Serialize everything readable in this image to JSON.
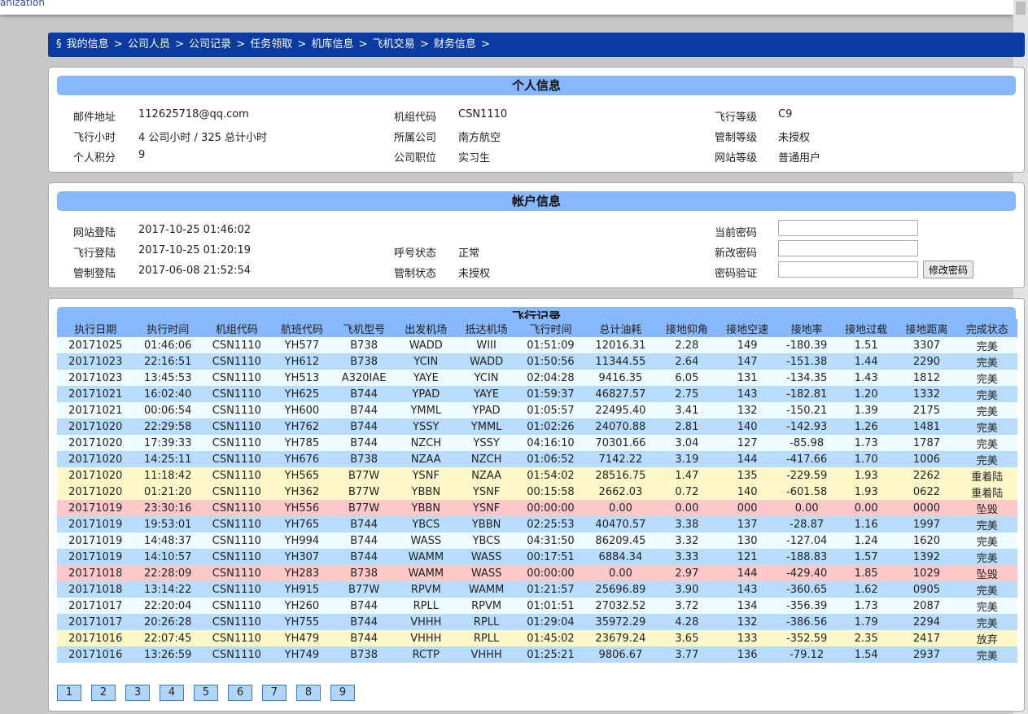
{
  "org_fragment": "anization",
  "breadcrumb": {
    "prefix": "§",
    "items": [
      "我的信息",
      "公司人员",
      "公司记录",
      "任务领取",
      "机库信息",
      "飞机交易",
      "财务信息"
    ],
    "separator": ">"
  },
  "personal": {
    "title": "个人信息",
    "fields": [
      {
        "label": "邮件地址",
        "value": "112625718@qq.com"
      },
      {
        "label": "机组代码",
        "value": "CSN1110"
      },
      {
        "label": "飞行等级",
        "value": "C9"
      },
      {
        "label": "飞行小时",
        "value": "4 公司小时 / 325 总计小时"
      },
      {
        "label": "所属公司",
        "value": "南方航空"
      },
      {
        "label": "管制等级",
        "value": "未授权"
      },
      {
        "label": "个人积分",
        "value": "9"
      },
      {
        "label": "公司职位",
        "value": "实习生"
      },
      {
        "label": "网站等级",
        "value": "普通用户"
      }
    ]
  },
  "account": {
    "title": "帐户信息",
    "site_login": {
      "label": "网站登陆",
      "value": "2017-10-25 01:46:02"
    },
    "flight_login": {
      "label": "飞行登陆",
      "value": "2017-10-25 01:20:19"
    },
    "control_login": {
      "label": "管制登陆",
      "value": "2017-06-08 21:52:54"
    },
    "callsign_status": {
      "label": "呼号状态",
      "value": "正常"
    },
    "control_status": {
      "label": "管制状态",
      "value": "未授权"
    },
    "current_password": {
      "label": "当前密码",
      "value": ""
    },
    "new_password": {
      "label": "新改密码",
      "value": ""
    },
    "verify_password": {
      "label": "密码验证",
      "value": ""
    },
    "change_button": "修改密码"
  },
  "records": {
    "title": "飞行记录",
    "headers": [
      "执行日期",
      "执行时间",
      "机组代码",
      "航班代码",
      "飞机型号",
      "出发机场",
      "抵达机场",
      "飞行时间",
      "总计油耗",
      "接地仰角",
      "接地空速",
      "接地率",
      "接地过载",
      "接地距离",
      "完成状态"
    ],
    "rows": [
      {
        "status": "normal",
        "cells": [
          "20171025",
          "01:46:06",
          "CSN1110",
          "YH577",
          "B738",
          "WADD",
          "WIII",
          "01:51:09",
          "12016.31",
          "2.28",
          "149",
          "-180.39",
          "1.51",
          "3307",
          "完美"
        ]
      },
      {
        "status": "normal",
        "cells": [
          "20171023",
          "22:16:51",
          "CSN1110",
          "YH612",
          "B738",
          "YCIN",
          "WADD",
          "01:50:56",
          "11344.55",
          "2.64",
          "147",
          "-151.38",
          "1.44",
          "2290",
          "完美"
        ]
      },
      {
        "status": "normal",
        "cells": [
          "20171023",
          "13:45:53",
          "CSN1110",
          "YH513",
          "A320IAE",
          "YAYE",
          "YCIN",
          "02:04:28",
          "9416.35",
          "6.05",
          "131",
          "-134.35",
          "1.43",
          "1812",
          "完美"
        ]
      },
      {
        "status": "normal",
        "cells": [
          "20171021",
          "16:02:40",
          "CSN1110",
          "YH625",
          "B744",
          "YPAD",
          "YAYE",
          "01:59:37",
          "46827.57",
          "2.75",
          "143",
          "-182.81",
          "1.20",
          "1332",
          "完美"
        ]
      },
      {
        "status": "normal",
        "cells": [
          "20171021",
          "00:06:54",
          "CSN1110",
          "YH600",
          "B744",
          "YMML",
          "YPAD",
          "01:05:57",
          "22495.40",
          "3.41",
          "132",
          "-150.21",
          "1.39",
          "2175",
          "完美"
        ]
      },
      {
        "status": "normal",
        "cells": [
          "20171020",
          "22:29:58",
          "CSN1110",
          "YH762",
          "B744",
          "YSSY",
          "YMML",
          "01:02:26",
          "24070.88",
          "2.81",
          "140",
          "-142.93",
          "1.26",
          "1481",
          "完美"
        ]
      },
      {
        "status": "normal",
        "cells": [
          "20171020",
          "17:39:33",
          "CSN1110",
          "YH785",
          "B744",
          "NZCH",
          "YSSY",
          "04:16:10",
          "70301.66",
          "3.04",
          "127",
          "-85.98",
          "1.73",
          "1787",
          "完美"
        ]
      },
      {
        "status": "normal",
        "cells": [
          "20171020",
          "14:25:11",
          "CSN1110",
          "YH676",
          "B738",
          "NZAA",
          "NZCH",
          "01:06:52",
          "7142.22",
          "3.19",
          "144",
          "-417.66",
          "1.70",
          "1006",
          "完美"
        ]
      },
      {
        "status": "heavy",
        "cells": [
          "20171020",
          "11:18:42",
          "CSN1110",
          "YH565",
          "B77W",
          "YSNF",
          "NZAA",
          "01:54:02",
          "28516.75",
          "1.47",
          "135",
          "-229.59",
          "1.93",
          "2262",
          "重着陆"
        ]
      },
      {
        "status": "heavy",
        "cells": [
          "20171020",
          "01:21:20",
          "CSN1110",
          "YH362",
          "B77W",
          "YBBN",
          "YSNF",
          "00:15:58",
          "2662.03",
          "0.72",
          "140",
          "-601.58",
          "1.93",
          "0622",
          "重着陆"
        ]
      },
      {
        "status": "crash",
        "cells": [
          "20171019",
          "23:30:16",
          "CSN1110",
          "YH556",
          "B77W",
          "YBBN",
          "YSNF",
          "00:00:00",
          "0.00",
          "0.00",
          "000",
          "0.00",
          "0.00",
          "0000",
          "坠毁"
        ]
      },
      {
        "status": "normal",
        "cells": [
          "20171019",
          "19:53:01",
          "CSN1110",
          "YH765",
          "B744",
          "YBCS",
          "YBBN",
          "02:25:53",
          "40470.57",
          "3.38",
          "137",
          "-28.87",
          "1.16",
          "1997",
          "完美"
        ]
      },
      {
        "status": "normal",
        "cells": [
          "20171019",
          "14:48:37",
          "CSN1110",
          "YH994",
          "B744",
          "WASS",
          "YBCS",
          "04:31:50",
          "86209.45",
          "3.32",
          "130",
          "-127.04",
          "1.24",
          "1620",
          "完美"
        ]
      },
      {
        "status": "normal",
        "cells": [
          "20171019",
          "14:10:57",
          "CSN1110",
          "YH307",
          "B744",
          "WAMM",
          "WASS",
          "00:17:51",
          "6884.34",
          "3.33",
          "121",
          "-188.83",
          "1.57",
          "1392",
          "完美"
        ]
      },
      {
        "status": "crash",
        "cells": [
          "20171018",
          "22:28:09",
          "CSN1110",
          "YH283",
          "B738",
          "WAMM",
          "WASS",
          "00:00:00",
          "0.00",
          "2.97",
          "144",
          "-429.40",
          "1.85",
          "1029",
          "坠毁"
        ]
      },
      {
        "status": "normal",
        "cells": [
          "20171018",
          "13:14:22",
          "CSN1110",
          "YH915",
          "B77W",
          "RPVM",
          "WAMM",
          "01:21:57",
          "25696.89",
          "3.90",
          "143",
          "-360.65",
          "1.62",
          "0905",
          "完美"
        ]
      },
      {
        "status": "normal",
        "cells": [
          "20171017",
          "22:20:04",
          "CSN1110",
          "YH260",
          "B744",
          "RPLL",
          "RPVM",
          "01:01:51",
          "27032.52",
          "3.72",
          "134",
          "-356.39",
          "1.73",
          "2087",
          "完美"
        ]
      },
      {
        "status": "normal",
        "cells": [
          "20171017",
          "20:26:28",
          "CSN1110",
          "YH755",
          "B744",
          "VHHH",
          "RPLL",
          "01:29:04",
          "35972.29",
          "4.28",
          "132",
          "-386.56",
          "1.79",
          "2294",
          "完美"
        ]
      },
      {
        "status": "heavy",
        "cells": [
          "20171016",
          "22:07:45",
          "CSN1110",
          "YH479",
          "B744",
          "VHHH",
          "RPLL",
          "01:45:02",
          "23679.24",
          "3.65",
          "133",
          "-352.59",
          "2.35",
          "2417",
          "放弃"
        ]
      },
      {
        "status": "normal",
        "cells": [
          "20171016",
          "13:26:59",
          "CSN1110",
          "YH749",
          "B738",
          "RCTP",
          "VHHH",
          "01:25:21",
          "9806.67",
          "3.77",
          "136",
          "-79.12",
          "1.54",
          "2937",
          "完美"
        ]
      }
    ]
  },
  "pagination": [
    "1",
    "2",
    "3",
    "4",
    "5",
    "6",
    "7",
    "8",
    "9"
  ]
}
